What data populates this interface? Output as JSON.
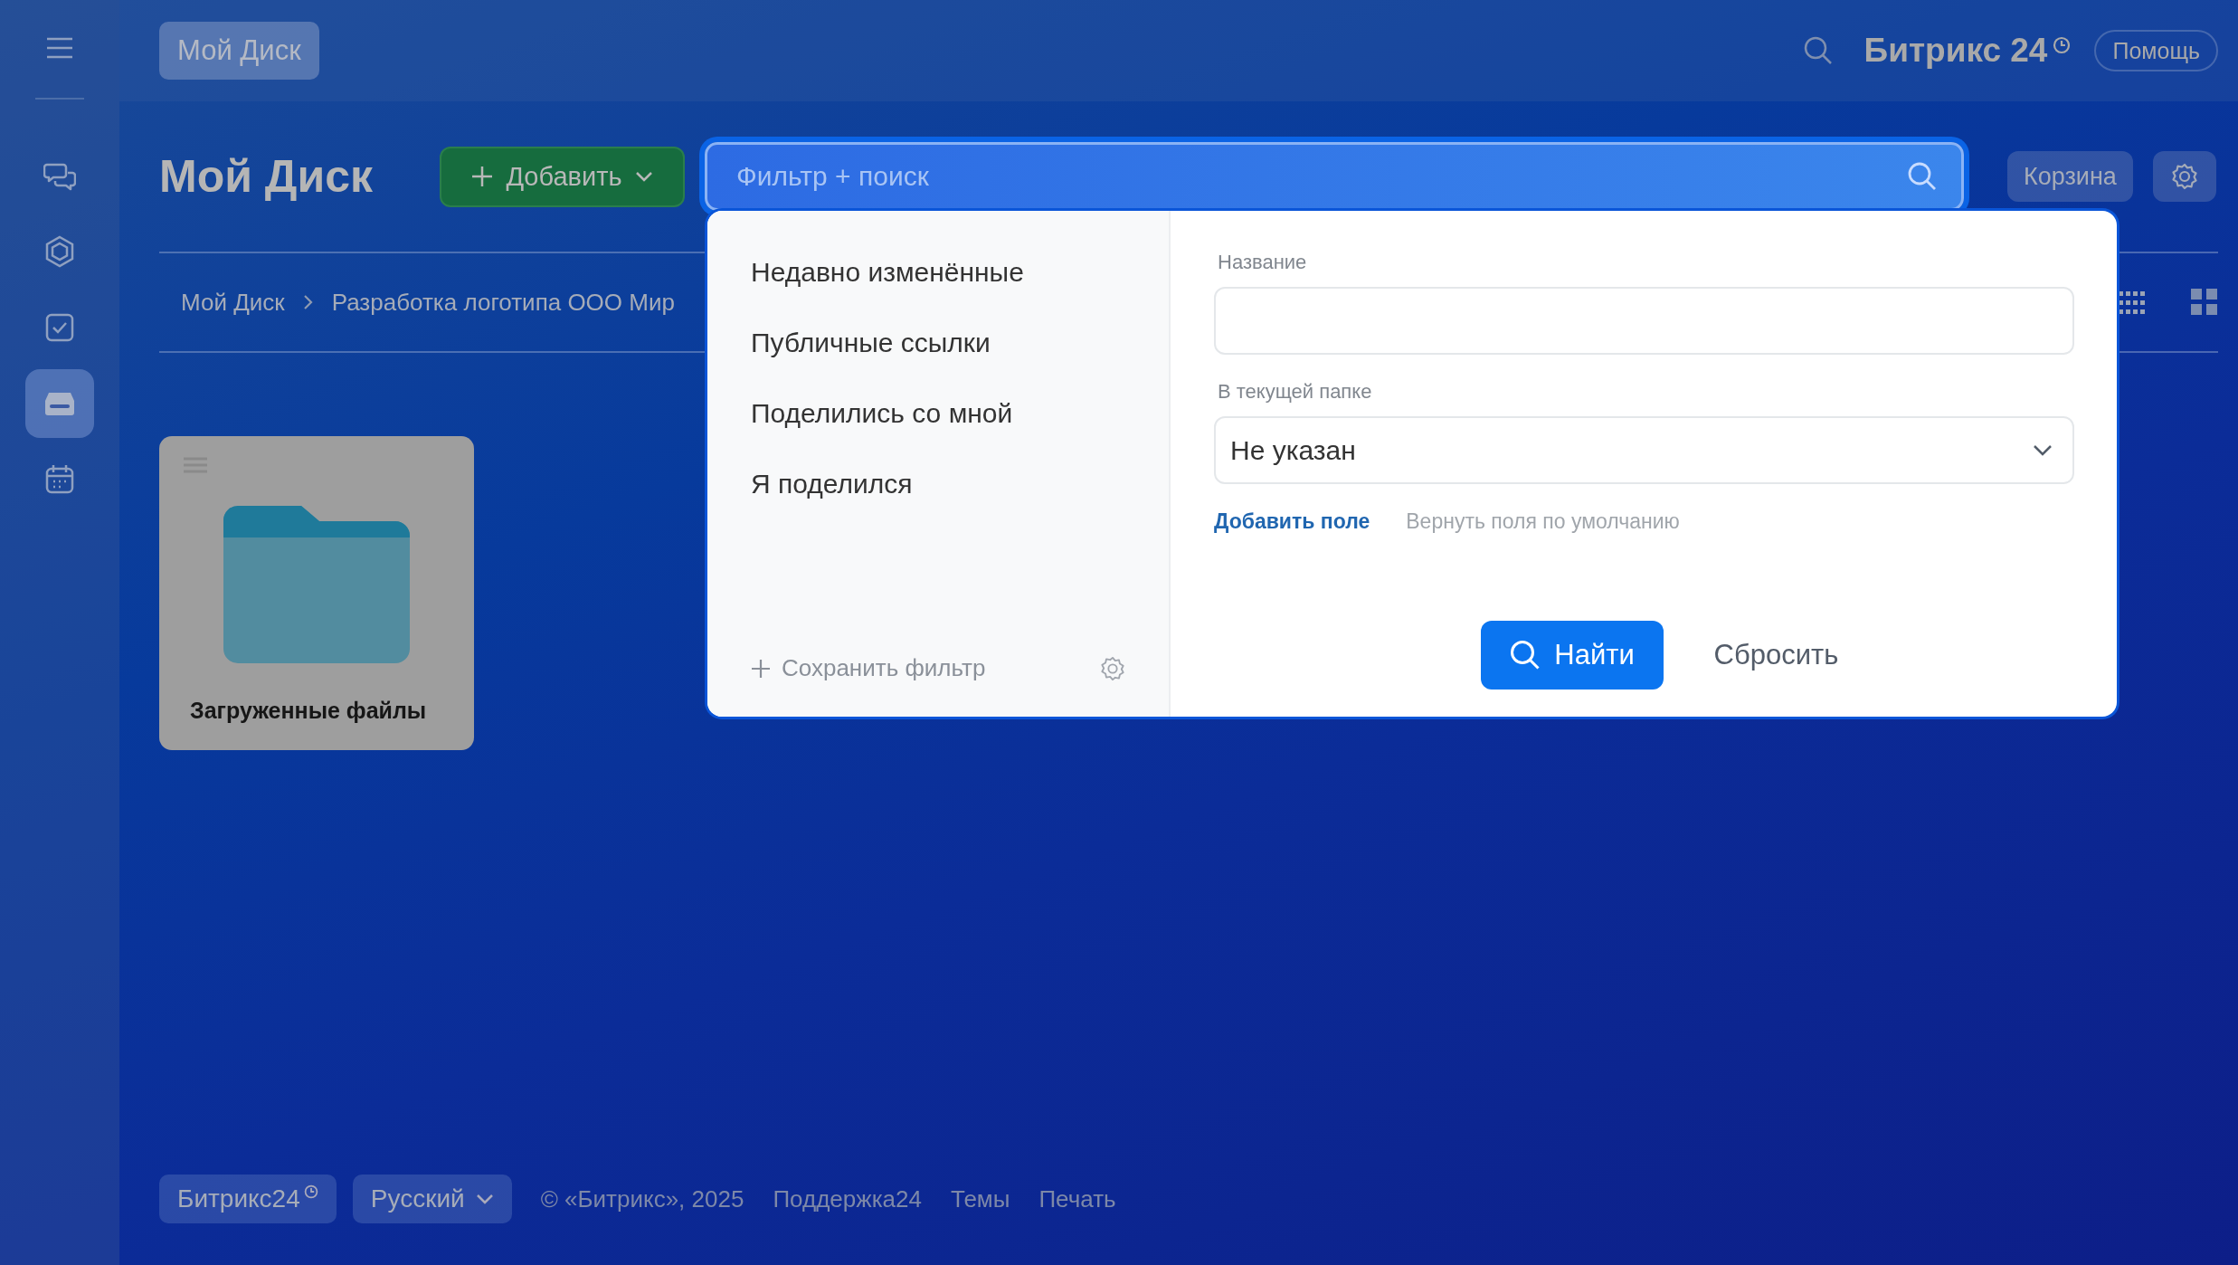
{
  "top_bar": {
    "section_button": "Мой Диск",
    "brand": "Битрикс 24",
    "help_button": "Помощь"
  },
  "sidebar": {
    "items": [
      {
        "kind": "chat",
        "selected": false
      },
      {
        "kind": "hexagon",
        "selected": false
      },
      {
        "kind": "tasks",
        "selected": false
      },
      {
        "kind": "disk",
        "selected": true
      },
      {
        "kind": "calendar",
        "selected": false
      }
    ]
  },
  "header": {
    "title": "Мой Диск",
    "add_button": "Добавить",
    "search": {
      "placeholder": "Фильтр + поиск"
    },
    "trash_button": "Корзина"
  },
  "breadcrumbs": [
    "Мой Диск",
    "Разработка логотипа ООО Мир"
  ],
  "view_modes": [
    {
      "kind": "list"
    },
    {
      "kind": "tiles"
    }
  ],
  "folders": [
    {
      "name": "Загруженные файлы"
    }
  ],
  "filter_popup": {
    "presets": [
      "Недавно изменённые",
      "Публичные ссылки",
      "Поделились со мной",
      "Я поделился"
    ],
    "save_filter": "Сохранить фильтр",
    "fields": [
      {
        "kind": "text",
        "label": "Название"
      },
      {
        "kind": "select",
        "label": "В текущей папке",
        "value": "Не указан"
      }
    ],
    "add_field": "Добавить поле",
    "restore_fields": "Вернуть поля по умолчанию",
    "find_button": "Найти",
    "reset_button": "Сбросить"
  },
  "footer": {
    "brand_button": "Битрикс24",
    "language_button": "Русский",
    "copyright": "© «Битрикс», 2025",
    "links": [
      "Поддержка24",
      "Темы",
      "Печать"
    ]
  }
}
